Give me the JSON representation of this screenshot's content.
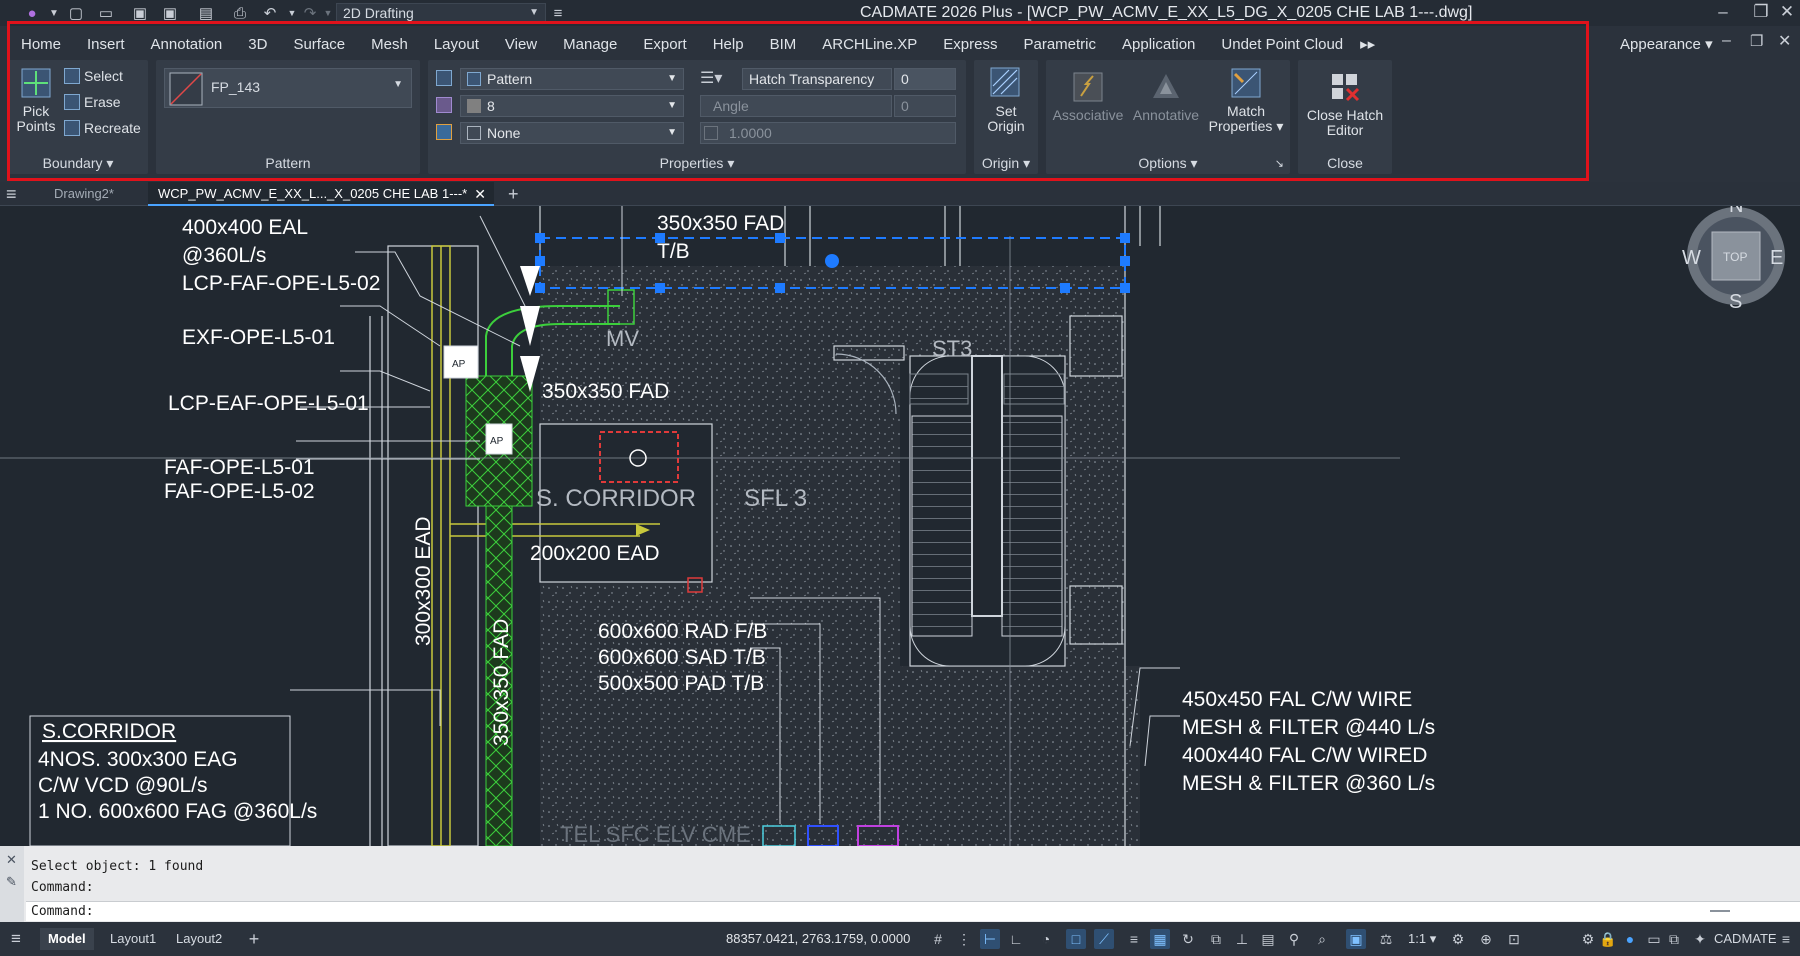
{
  "title_bar": {
    "workspace": "2D Drafting",
    "app_title": "CADMATE 2026 Plus - [WCP_PW_ACMV_E_XX_L5_DG_X_0205 CHE LAB 1---.dwg]"
  },
  "ribbon": {
    "tabs": [
      "Home",
      "Insert",
      "Annotation",
      "3D",
      "Surface",
      "Mesh",
      "Layout",
      "View",
      "Manage",
      "Export",
      "Help",
      "BIM",
      "ARCHLine.XP",
      "Express",
      "Parametric",
      "Application",
      "Undet Point Cloud"
    ],
    "appearance": "Appearance",
    "boundary": {
      "pick_points": "Pick Points",
      "select": "Select",
      "erase": "Erase",
      "recreate": "Recreate",
      "title": "Boundary"
    },
    "pattern": {
      "selected": "FP_143",
      "title": "Pattern"
    },
    "properties": {
      "hatch_type": "Pattern",
      "color": "8",
      "background": "None",
      "transparency_label": "Hatch Transparency",
      "transparency_value": "0",
      "angle_label": "Angle",
      "angle_value": "0",
      "scale_value": "1.0000",
      "title": "Properties"
    },
    "origin": {
      "set_origin": "Set Origin",
      "title": "Origin"
    },
    "options": {
      "associative": "Associative",
      "annotative": "Annotative",
      "match_properties": "Match Properties",
      "title": "Options"
    },
    "close": {
      "close_hatch_editor": "Close Hatch Editor",
      "title": "Close"
    }
  },
  "document_tabs": {
    "tabs": [
      "Drawing2*",
      "WCP_PW_ACMV_E_XX_L..._X_0205 CHE LAB 1---*"
    ]
  },
  "drawing": {
    "labels": {
      "eal": "400x400 EAL",
      "eal_flow": "@360L/s",
      "fad_top": "350x350 FAD",
      "fad_top_tb": "T/B",
      "lcp_faf": "LCP-FAF-OPE-L5-02",
      "exf": "EXF-OPE-L5-01",
      "lcp_eaf": "LCP-EAF-OPE-L5-01",
      "fad_mid": "350x350 FAD",
      "faf1": "FAF-OPE-L5-01",
      "faf2": "FAF-OPE-L5-02",
      "st3": "ST3",
      "corridor": "S. CORRIDOR",
      "sfl3": "SFL 3",
      "ead_small": "200x200 EAD",
      "ead_vert": "300x300 EAD",
      "fad_vert": "350x350 FAD",
      "rad": "600x600 RAD F/B",
      "sad": "600x600 SAD T/B",
      "pad": "500x500 PAD T/B",
      "mv": "MV",
      "ap": "AP",
      "fal1": "450x450 FAL C/W WIRE",
      "fal1b": "MESH & FILTER @440 L/s",
      "fal2": "400x440 FAL C/W WIRED",
      "fal2b": "MESH & FILTER @360 L/s",
      "bottom_partial": "TEL   SFC   ELV   CME"
    },
    "note_box": {
      "title": "S.CORRIDOR",
      "line1": "4NOS. 300x300 EAG",
      "line2": "C/W VCD @90L/s",
      "line3": "1 NO. 600x600 FAG @360L/s"
    },
    "viewcube": {
      "n": "N",
      "s": "S",
      "e": "E",
      "w": "W",
      "top": "TOP"
    }
  },
  "command_line": {
    "history1": "Select object:  1 found",
    "history2": "Command:",
    "prompt": "Command:"
  },
  "status_bar": {
    "layouts": [
      "Model",
      "Layout1",
      "Layout2"
    ],
    "coordinates": "88357.0421, 2763.1759, 0.0000",
    "scale": "1:1",
    "brand": "CADMATE"
  },
  "colors": {
    "highlight": "#e0121b",
    "grip": "#1e7bff",
    "duct_green": "#3ccf3c",
    "duct_yellow": "#c8c83c",
    "hatch": "#9aa3ad"
  }
}
